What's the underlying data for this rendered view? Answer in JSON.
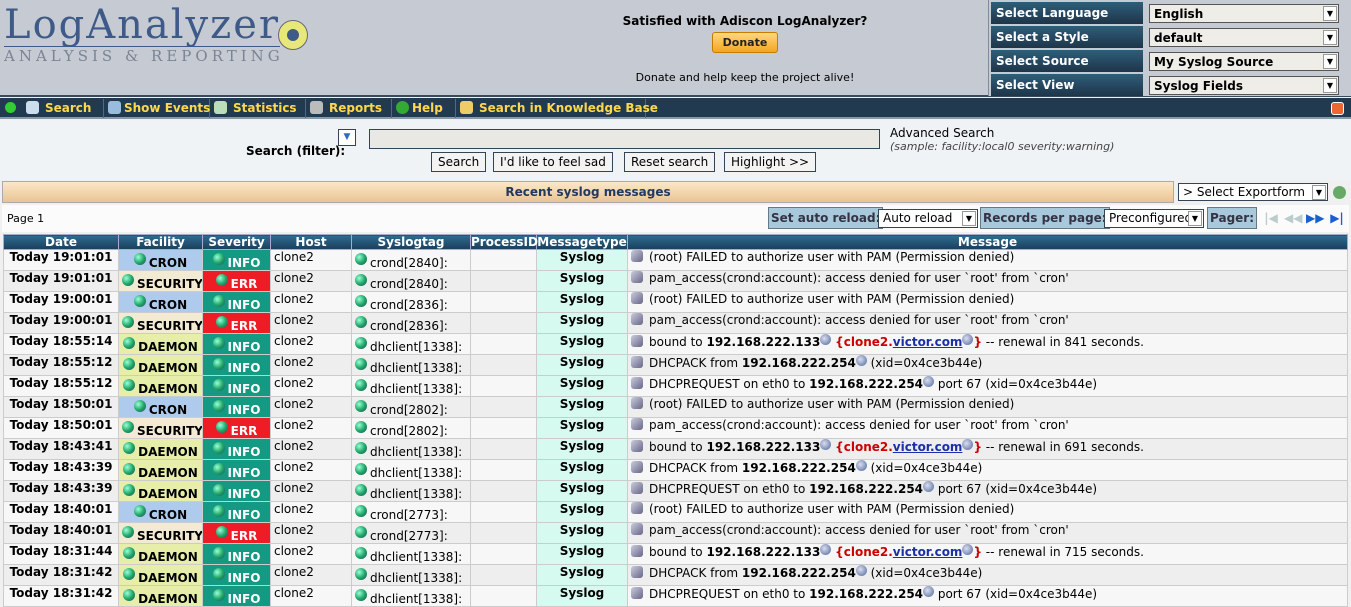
{
  "header": {
    "logo_title": "LogAnalyzer",
    "logo_subtitle": "ANALYSIS & REPORTING",
    "donate_question": "Satisfied with Adiscon LogAnalyzer?",
    "donate_button": "Donate",
    "donate_sub": "Donate and help keep the project alive!"
  },
  "selectors": [
    {
      "label": "Select Language",
      "value": "English"
    },
    {
      "label": "Select a Style",
      "value": "default"
    },
    {
      "label": "Select Source",
      "value": "My Syslog Source"
    },
    {
      "label": "Select View",
      "value": "Syslog Fields"
    }
  ],
  "nav": [
    "Search",
    "Show Events",
    "Statistics",
    "Reports",
    "Help",
    "Search in Knowledge Base"
  ],
  "search": {
    "label": "Search (filter):",
    "value": "",
    "buttons": [
      "Search",
      "I'd like to feel sad",
      "Reset search",
      "Highlight >>"
    ],
    "advanced": "Advanced Search",
    "sample": "(sample: facility:local0 severity:warning)"
  },
  "recent_title": "Recent syslog messages",
  "export": "> Select Exportform",
  "paging": {
    "page": "Page 1",
    "auto_reload_label": "Set auto reload:",
    "auto_reload_value": "Auto reload",
    "records_label": "Records per page:",
    "records_value": "Preconfigured",
    "pager_label": "Pager:"
  },
  "columns": [
    "Date",
    "Facility",
    "Severity",
    "Host",
    "Syslogtag",
    "ProcessID",
    "Messagetype",
    "Message"
  ],
  "colors": {
    "CRON": "#aecbee",
    "SECURITY": "#f2ead2",
    "DAEMON": "#e6eeaa",
    "INFO": "#149a82",
    "ERR": "#ee1c24"
  },
  "rows": [
    {
      "date": "Today 19:01:01",
      "facility": "CRON",
      "severity": "INFO",
      "host": "clone2",
      "tag": "crond[2840]:",
      "pid": "",
      "type": "Syslog",
      "msg": {
        "pre": "(root) FAILED to authorize user with PAM (Permission denied)"
      }
    },
    {
      "date": "Today 19:01:01",
      "facility": "SECURITY",
      "severity": "ERR",
      "host": "clone2",
      "tag": "crond[2840]:",
      "pid": "",
      "type": "Syslog",
      "msg": {
        "pre": "pam_access(crond:account): access denied for user `root' from `cron'"
      }
    },
    {
      "date": "Today 19:00:01",
      "facility": "CRON",
      "severity": "INFO",
      "host": "clone2",
      "tag": "crond[2836]:",
      "pid": "",
      "type": "Syslog",
      "msg": {
        "pre": "(root) FAILED to authorize user with PAM (Permission denied)"
      }
    },
    {
      "date": "Today 19:00:01",
      "facility": "SECURITY",
      "severity": "ERR",
      "host": "clone2",
      "tag": "crond[2836]:",
      "pid": "",
      "type": "Syslog",
      "msg": {
        "pre": "pam_access(crond:account): access denied for user `root' from `cron'"
      }
    },
    {
      "date": "Today 18:55:14",
      "facility": "DAEMON",
      "severity": "INFO",
      "host": "clone2",
      "tag": "dhclient[1338]:",
      "pid": "",
      "type": "Syslog",
      "msg": {
        "pre": "bound to ",
        "ip": "192.168.222.133",
        "host_a": "clone2.",
        "host_b": "victor.com",
        "post": " -- renewal in 841 seconds."
      }
    },
    {
      "date": "Today 18:55:12",
      "facility": "DAEMON",
      "severity": "INFO",
      "host": "clone2",
      "tag": "dhclient[1338]:",
      "pid": "",
      "type": "Syslog",
      "msg": {
        "pre": "DHCPACK from ",
        "ip": "192.168.222.254",
        "post": " (xid=0x4ce3b44e)"
      }
    },
    {
      "date": "Today 18:55:12",
      "facility": "DAEMON",
      "severity": "INFO",
      "host": "clone2",
      "tag": "dhclient[1338]:",
      "pid": "",
      "type": "Syslog",
      "msg": {
        "pre": "DHCPREQUEST on eth0 to ",
        "ip": "192.168.222.254",
        "post": " port 67 (xid=0x4ce3b44e)"
      }
    },
    {
      "date": "Today 18:50:01",
      "facility": "CRON",
      "severity": "INFO",
      "host": "clone2",
      "tag": "crond[2802]:",
      "pid": "",
      "type": "Syslog",
      "msg": {
        "pre": "(root) FAILED to authorize user with PAM (Permission denied)"
      }
    },
    {
      "date": "Today 18:50:01",
      "facility": "SECURITY",
      "severity": "ERR",
      "host": "clone2",
      "tag": "crond[2802]:",
      "pid": "",
      "type": "Syslog",
      "msg": {
        "pre": "pam_access(crond:account): access denied for user `root' from `cron'"
      }
    },
    {
      "date": "Today 18:43:41",
      "facility": "DAEMON",
      "severity": "INFO",
      "host": "clone2",
      "tag": "dhclient[1338]:",
      "pid": "",
      "type": "Syslog",
      "msg": {
        "pre": "bound to ",
        "ip": "192.168.222.133",
        "host_a": "clone2.",
        "host_b": "victor.com",
        "post": " -- renewal in 691 seconds."
      }
    },
    {
      "date": "Today 18:43:39",
      "facility": "DAEMON",
      "severity": "INFO",
      "host": "clone2",
      "tag": "dhclient[1338]:",
      "pid": "",
      "type": "Syslog",
      "msg": {
        "pre": "DHCPACK from ",
        "ip": "192.168.222.254",
        "post": " (xid=0x4ce3b44e)"
      }
    },
    {
      "date": "Today 18:43:39",
      "facility": "DAEMON",
      "severity": "INFO",
      "host": "clone2",
      "tag": "dhclient[1338]:",
      "pid": "",
      "type": "Syslog",
      "msg": {
        "pre": "DHCPREQUEST on eth0 to ",
        "ip": "192.168.222.254",
        "post": " port 67 (xid=0x4ce3b44e)"
      }
    },
    {
      "date": "Today 18:40:01",
      "facility": "CRON",
      "severity": "INFO",
      "host": "clone2",
      "tag": "crond[2773]:",
      "pid": "",
      "type": "Syslog",
      "msg": {
        "pre": "(root) FAILED to authorize user with PAM (Permission denied)"
      }
    },
    {
      "date": "Today 18:40:01",
      "facility": "SECURITY",
      "severity": "ERR",
      "host": "clone2",
      "tag": "crond[2773]:",
      "pid": "",
      "type": "Syslog",
      "msg": {
        "pre": "pam_access(crond:account): access denied for user `root' from `cron'"
      }
    },
    {
      "date": "Today 18:31:44",
      "facility": "DAEMON",
      "severity": "INFO",
      "host": "clone2",
      "tag": "dhclient[1338]:",
      "pid": "",
      "type": "Syslog",
      "msg": {
        "pre": "bound to ",
        "ip": "192.168.222.133",
        "host_a": "clone2.",
        "host_b": "victor.com",
        "post": " -- renewal in 715 seconds."
      }
    },
    {
      "date": "Today 18:31:42",
      "facility": "DAEMON",
      "severity": "INFO",
      "host": "clone2",
      "tag": "dhclient[1338]:",
      "pid": "",
      "type": "Syslog",
      "msg": {
        "pre": "DHCPACK from ",
        "ip": "192.168.222.254",
        "post": " (xid=0x4ce3b44e)"
      }
    },
    {
      "date": "Today 18:31:42",
      "facility": "DAEMON",
      "severity": "INFO",
      "host": "clone2",
      "tag": "dhclient[1338]:",
      "pid": "",
      "type": "Syslog",
      "msg": {
        "pre": "DHCPREQUEST on eth0 to ",
        "ip": "192.168.222.254",
        "post": " port 67 (xid=0x4ce3b44e)"
      }
    }
  ]
}
